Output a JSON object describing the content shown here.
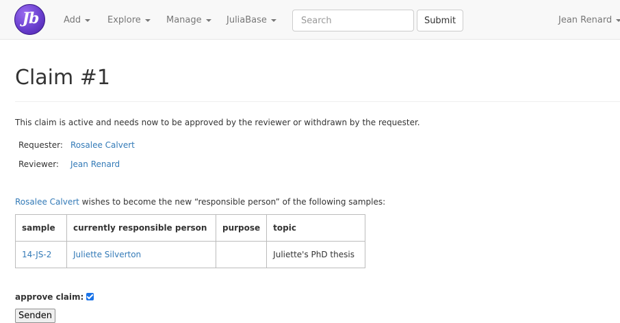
{
  "app": {
    "logo_text": "Jb"
  },
  "nav": {
    "items": [
      {
        "label": "Add"
      },
      {
        "label": "Explore"
      },
      {
        "label": "Manage"
      },
      {
        "label": "JuliaBase"
      }
    ],
    "search_placeholder": "Search",
    "submit_label": "Submit",
    "user_label": "Jean Renard"
  },
  "page": {
    "title": "Claim #1",
    "intro": "This claim is active and needs now to be approved by the reviewer or withdrawn by the requester.",
    "requester_label": "Requester:",
    "requester_name": "Rosalee Calvert",
    "reviewer_label": "Reviewer:",
    "reviewer_name": "Jean Renard",
    "sentence_person": "Rosalee Calvert",
    "sentence_rest": " wishes to become the new “responsible person” of the following samples:"
  },
  "table": {
    "headers": [
      "sample",
      "currently responsible person",
      "purpose",
      "topic"
    ],
    "rows": [
      {
        "sample": "14-JS-2",
        "person": "Juliette Silverton",
        "purpose": "",
        "topic": "Juliette's PhD thesis"
      }
    ]
  },
  "form": {
    "approve_label": "approve claim:",
    "approve_checked": true,
    "send_label": "Senden"
  },
  "colors": {
    "link": "#337ab7",
    "navbar_bg": "#f8f8f8",
    "logo": "#6a3fcf",
    "checkbox": "#1a73e8"
  }
}
